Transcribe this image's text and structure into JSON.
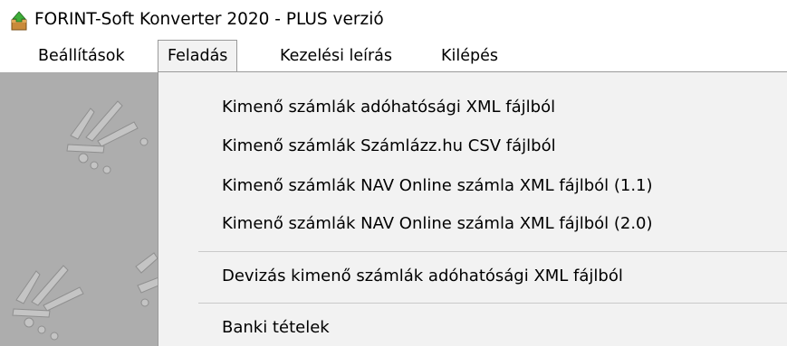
{
  "window": {
    "title": "FORINT-Soft Konverter 2020 - PLUS verzió",
    "icon": "app-package-icon"
  },
  "menubar": {
    "items": [
      {
        "label": "Beállítások"
      },
      {
        "label": "Feladás",
        "open": true
      },
      {
        "label": "Kezelési leírás"
      },
      {
        "label": "Kilépés"
      }
    ]
  },
  "dropdown": {
    "items": [
      {
        "label": "Kimenő számlák adóhatósági XML fájlból"
      },
      {
        "label": "Kimenő számlák Számlázz.hu CSV fájlból"
      },
      {
        "label": "Kimenő számlák NAV Online számla XML fájlból (1.1)"
      },
      {
        "label": "Kimenő számlák NAV Online számla XML fájlból (2.0)"
      },
      {
        "label": "Devizás kimenő számlák adóhatósági XML fájlból"
      },
      {
        "label": "Banki tételek"
      }
    ]
  },
  "colors": {
    "menu_background": "#f2f2f2",
    "client_background": "#adadad",
    "separator": "#c9c9c9"
  }
}
